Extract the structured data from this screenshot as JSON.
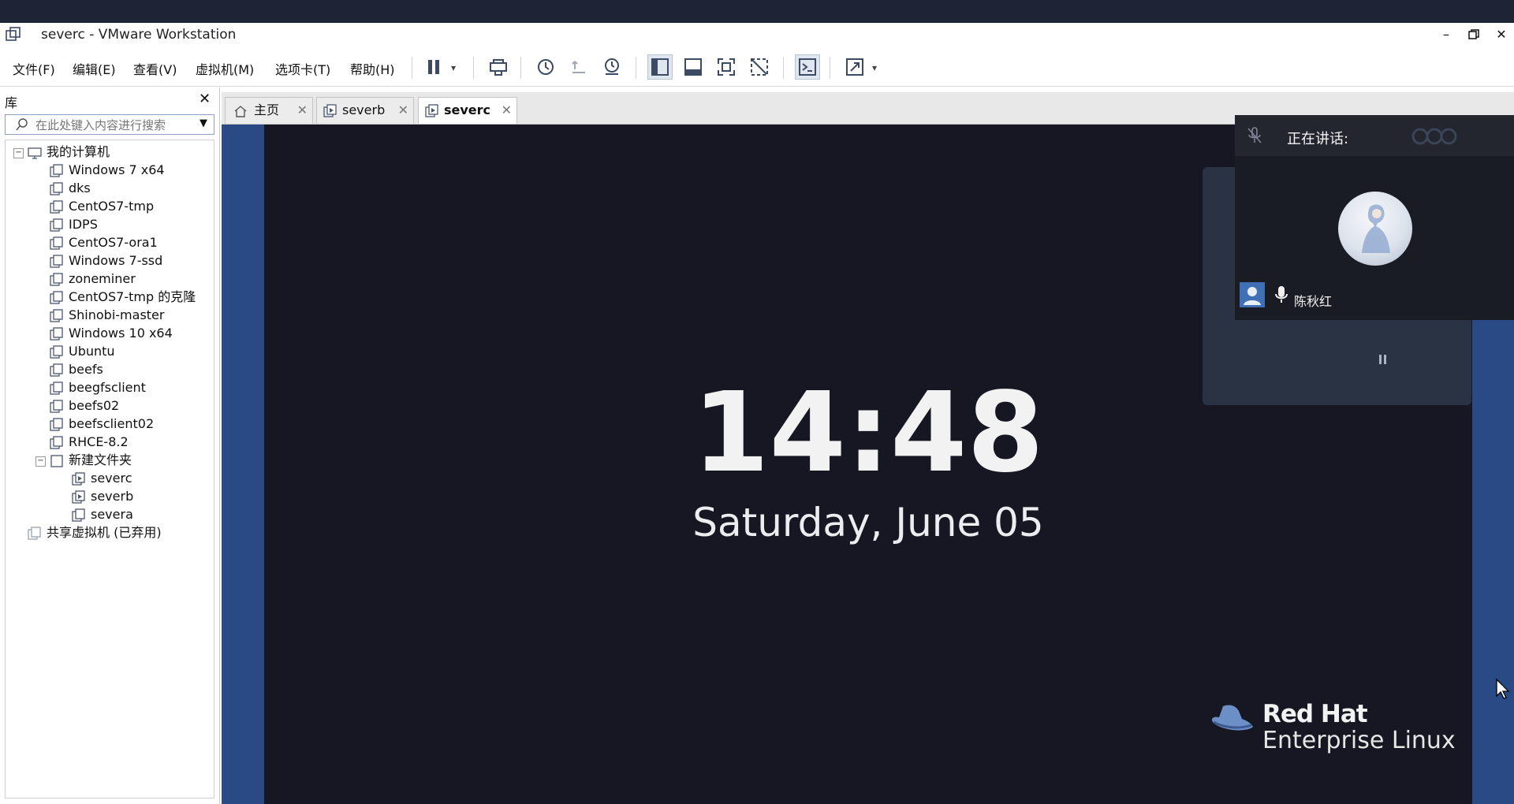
{
  "window": {
    "title": "severc - VMware Workstation",
    "controls": [
      "minimize",
      "maximize",
      "close"
    ]
  },
  "menu": {
    "file": "文件(F)",
    "edit": "编辑(E)",
    "view": "查看(V)",
    "vm": "虚拟机(M)",
    "tabs": "选项卡(T)",
    "help": "帮助(H)"
  },
  "toolbar_icons": [
    "pause-icon",
    "send-ctrl-alt-del-icon",
    "snapshot-icon",
    "revert-snapshot-icon",
    "snapshot-manager-icon",
    "library-view-icon",
    "thumbnail-bar-icon",
    "fullscreen-icon",
    "unity-icon",
    "console-view-icon",
    "stretch-guest-icon"
  ],
  "library": {
    "title": "库",
    "search_placeholder": "在此处键入内容进行搜索",
    "root": "我的计算机",
    "items": [
      "Windows 7 x64",
      "dks",
      "CentOS7-tmp",
      "IDPS",
      "CentOS7-ora1",
      "Windows 7-ssd",
      "zoneminer",
      "CentOS7-tmp 的克隆",
      "Shinobi-master",
      "Windows 10 x64",
      "Ubuntu",
      "beefs",
      "beegfsclient",
      "beefs02",
      "beefsclient02",
      "RHCE-8.2"
    ],
    "folder": "新建文件夹",
    "folder_items": [
      "severc",
      "severb",
      "severa"
    ],
    "shared": "共享虚拟机 (已弃用)"
  },
  "tabs": [
    {
      "label": "主页",
      "active": false
    },
    {
      "label": "severb",
      "active": false
    },
    {
      "label": "severc",
      "active": true
    }
  ],
  "guest": {
    "time": "14:48",
    "date": "Saturday, June 05",
    "brand_line1": "Red Hat",
    "brand_line2": "Enterprise Linux"
  },
  "meeting": {
    "speaking_label": "正在讲话:",
    "participant": "陈秋红"
  },
  "colors": {
    "guest_bg": "#161722",
    "vm_border": "#2a4a86",
    "panel": "#2a3344"
  }
}
